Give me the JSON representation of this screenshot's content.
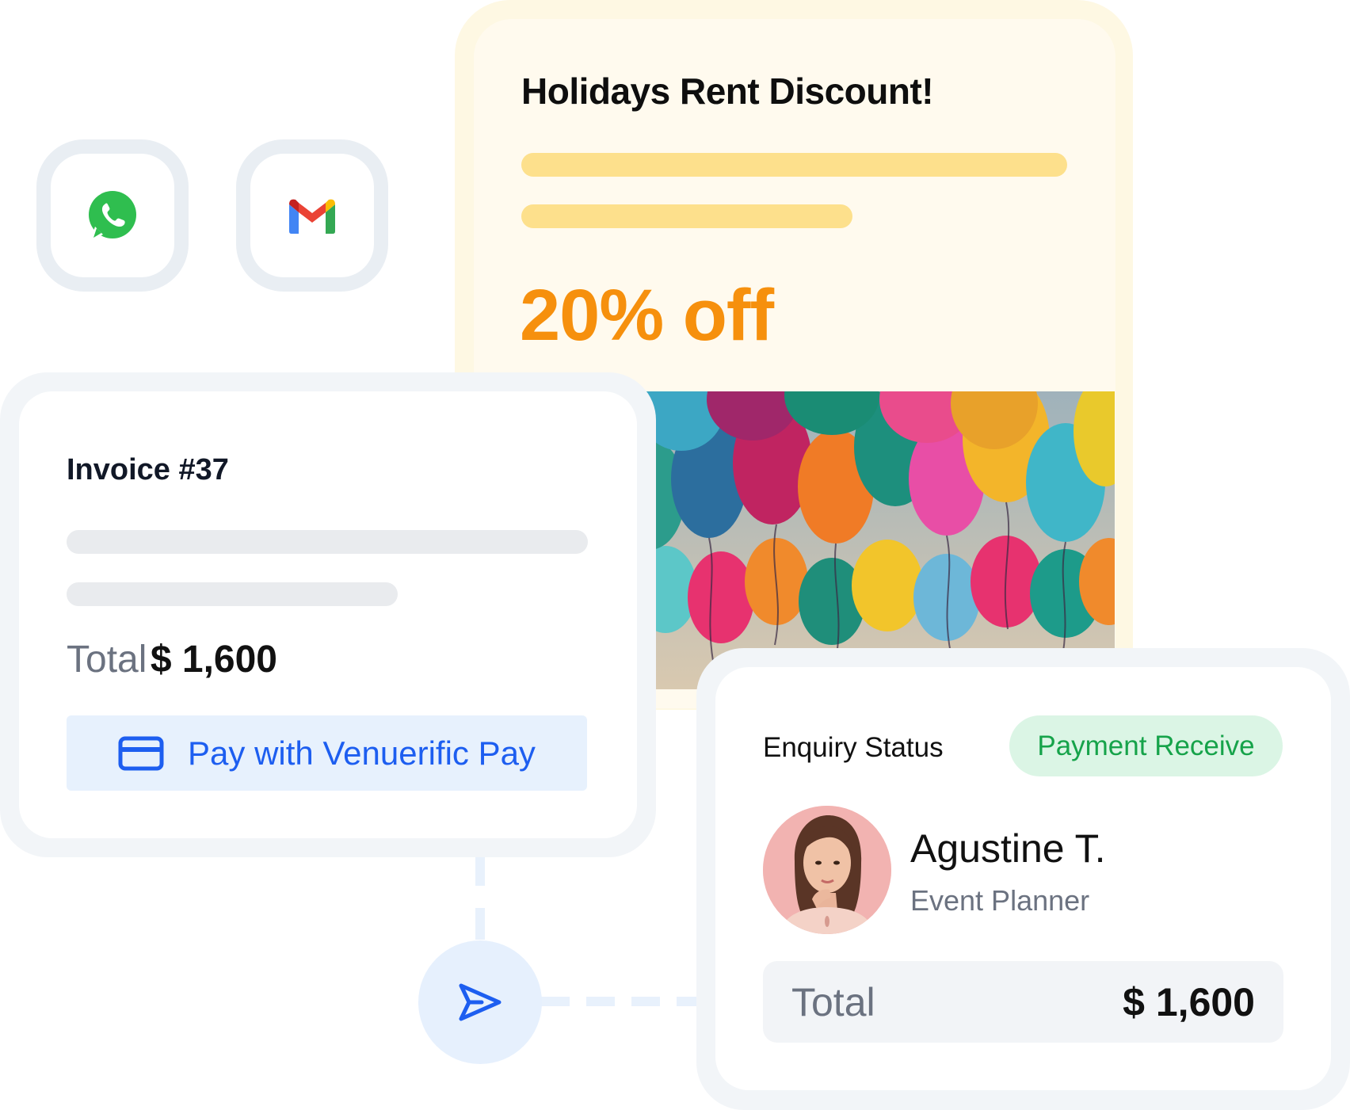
{
  "apps": {
    "whatsapp": {
      "icon": "whatsapp-icon"
    },
    "gmail": {
      "icon": "gmail-icon"
    }
  },
  "promo": {
    "title": "Holidays Rent Discount!",
    "discount": "20% off",
    "image": "party-balloons-image"
  },
  "invoice": {
    "title": "Invoice #37",
    "total_label": "Total",
    "total_value": "$ 1,600",
    "pay_button": {
      "label": "Pay with Venuerific Pay",
      "icon": "credit-card-icon"
    }
  },
  "connector": {
    "icon": "send-icon"
  },
  "enquiry": {
    "label": "Enquiry Status",
    "status": "Payment Receive",
    "person": {
      "name": "Agustine T.",
      "role": "Event Planner",
      "avatar": "avatar-photo"
    },
    "total_label": "Total",
    "total_value": "$ 1,600"
  },
  "colors": {
    "accent_orange": "#f6900d",
    "accent_blue": "#1d5ef0",
    "status_green": "#16a34a",
    "status_green_bg": "#dbf5e5",
    "promo_bg": "#fffaee",
    "promo_line": "#fde08c"
  }
}
